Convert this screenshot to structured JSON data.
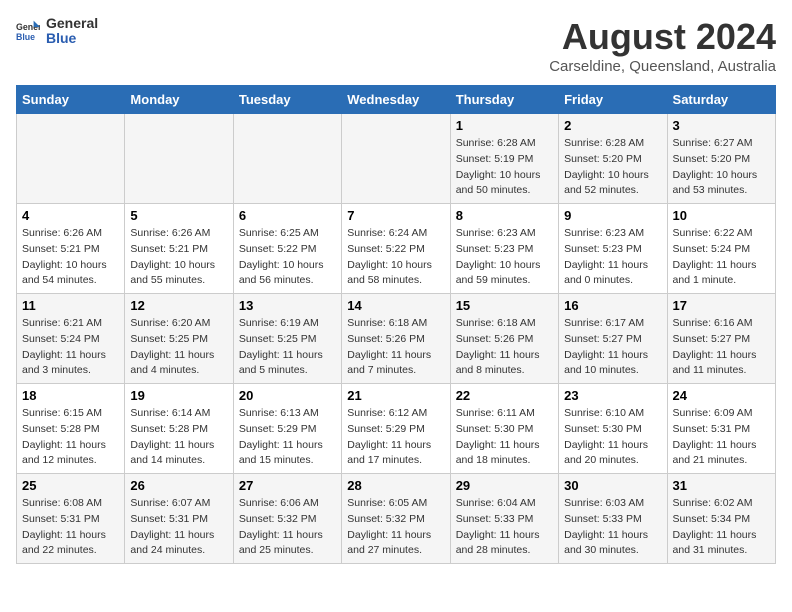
{
  "header": {
    "logo_general": "General",
    "logo_blue": "Blue",
    "title": "August 2024",
    "subtitle": "Carseldine, Queensland, Australia"
  },
  "calendar": {
    "days_of_week": [
      "Sunday",
      "Monday",
      "Tuesday",
      "Wednesday",
      "Thursday",
      "Friday",
      "Saturday"
    ],
    "weeks": [
      [
        {
          "day": "",
          "info": ""
        },
        {
          "day": "",
          "info": ""
        },
        {
          "day": "",
          "info": ""
        },
        {
          "day": "",
          "info": ""
        },
        {
          "day": "1",
          "info": "Sunrise: 6:28 AM\nSunset: 5:19 PM\nDaylight: 10 hours\nand 50 minutes."
        },
        {
          "day": "2",
          "info": "Sunrise: 6:28 AM\nSunset: 5:20 PM\nDaylight: 10 hours\nand 52 minutes."
        },
        {
          "day": "3",
          "info": "Sunrise: 6:27 AM\nSunset: 5:20 PM\nDaylight: 10 hours\nand 53 minutes."
        }
      ],
      [
        {
          "day": "4",
          "info": "Sunrise: 6:26 AM\nSunset: 5:21 PM\nDaylight: 10 hours\nand 54 minutes."
        },
        {
          "day": "5",
          "info": "Sunrise: 6:26 AM\nSunset: 5:21 PM\nDaylight: 10 hours\nand 55 minutes."
        },
        {
          "day": "6",
          "info": "Sunrise: 6:25 AM\nSunset: 5:22 PM\nDaylight: 10 hours\nand 56 minutes."
        },
        {
          "day": "7",
          "info": "Sunrise: 6:24 AM\nSunset: 5:22 PM\nDaylight: 10 hours\nand 58 minutes."
        },
        {
          "day": "8",
          "info": "Sunrise: 6:23 AM\nSunset: 5:23 PM\nDaylight: 10 hours\nand 59 minutes."
        },
        {
          "day": "9",
          "info": "Sunrise: 6:23 AM\nSunset: 5:23 PM\nDaylight: 11 hours\nand 0 minutes."
        },
        {
          "day": "10",
          "info": "Sunrise: 6:22 AM\nSunset: 5:24 PM\nDaylight: 11 hours\nand 1 minute."
        }
      ],
      [
        {
          "day": "11",
          "info": "Sunrise: 6:21 AM\nSunset: 5:24 PM\nDaylight: 11 hours\nand 3 minutes."
        },
        {
          "day": "12",
          "info": "Sunrise: 6:20 AM\nSunset: 5:25 PM\nDaylight: 11 hours\nand 4 minutes."
        },
        {
          "day": "13",
          "info": "Sunrise: 6:19 AM\nSunset: 5:25 PM\nDaylight: 11 hours\nand 5 minutes."
        },
        {
          "day": "14",
          "info": "Sunrise: 6:18 AM\nSunset: 5:26 PM\nDaylight: 11 hours\nand 7 minutes."
        },
        {
          "day": "15",
          "info": "Sunrise: 6:18 AM\nSunset: 5:26 PM\nDaylight: 11 hours\nand 8 minutes."
        },
        {
          "day": "16",
          "info": "Sunrise: 6:17 AM\nSunset: 5:27 PM\nDaylight: 11 hours\nand 10 minutes."
        },
        {
          "day": "17",
          "info": "Sunrise: 6:16 AM\nSunset: 5:27 PM\nDaylight: 11 hours\nand 11 minutes."
        }
      ],
      [
        {
          "day": "18",
          "info": "Sunrise: 6:15 AM\nSunset: 5:28 PM\nDaylight: 11 hours\nand 12 minutes."
        },
        {
          "day": "19",
          "info": "Sunrise: 6:14 AM\nSunset: 5:28 PM\nDaylight: 11 hours\nand 14 minutes."
        },
        {
          "day": "20",
          "info": "Sunrise: 6:13 AM\nSunset: 5:29 PM\nDaylight: 11 hours\nand 15 minutes."
        },
        {
          "day": "21",
          "info": "Sunrise: 6:12 AM\nSunset: 5:29 PM\nDaylight: 11 hours\nand 17 minutes."
        },
        {
          "day": "22",
          "info": "Sunrise: 6:11 AM\nSunset: 5:30 PM\nDaylight: 11 hours\nand 18 minutes."
        },
        {
          "day": "23",
          "info": "Sunrise: 6:10 AM\nSunset: 5:30 PM\nDaylight: 11 hours\nand 20 minutes."
        },
        {
          "day": "24",
          "info": "Sunrise: 6:09 AM\nSunset: 5:31 PM\nDaylight: 11 hours\nand 21 minutes."
        }
      ],
      [
        {
          "day": "25",
          "info": "Sunrise: 6:08 AM\nSunset: 5:31 PM\nDaylight: 11 hours\nand 22 minutes."
        },
        {
          "day": "26",
          "info": "Sunrise: 6:07 AM\nSunset: 5:31 PM\nDaylight: 11 hours\nand 24 minutes."
        },
        {
          "day": "27",
          "info": "Sunrise: 6:06 AM\nSunset: 5:32 PM\nDaylight: 11 hours\nand 25 minutes."
        },
        {
          "day": "28",
          "info": "Sunrise: 6:05 AM\nSunset: 5:32 PM\nDaylight: 11 hours\nand 27 minutes."
        },
        {
          "day": "29",
          "info": "Sunrise: 6:04 AM\nSunset: 5:33 PM\nDaylight: 11 hours\nand 28 minutes."
        },
        {
          "day": "30",
          "info": "Sunrise: 6:03 AM\nSunset: 5:33 PM\nDaylight: 11 hours\nand 30 minutes."
        },
        {
          "day": "31",
          "info": "Sunrise: 6:02 AM\nSunset: 5:34 PM\nDaylight: 11 hours\nand 31 minutes."
        }
      ]
    ]
  }
}
